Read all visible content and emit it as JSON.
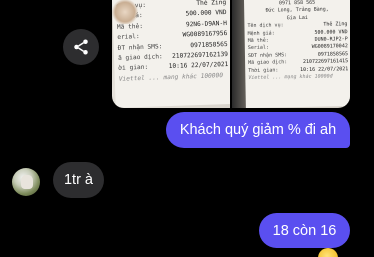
{
  "colors": {
    "background": "#000000",
    "outgoing_bubble": "#5a4ff0",
    "incoming_bubble": "#2d2d2f",
    "share_button": "#2d2d2f"
  },
  "photos": {
    "left_receipt": {
      "lines": [
        {
          "label": "dịch vụ:",
          "value": "Thẻ Zing"
        },
        {
          "label": "nh giá:",
          "value": "500.000 VND"
        },
        {
          "label": "Mã thẻ:",
          "value": "92N6-D9AN-H"
        },
        {
          "label": "erial:",
          "value": "WG0089167956"
        },
        {
          "label": "ĐT nhận SMS:",
          "value": "0971858565"
        },
        {
          "label": "ã giao dịch:",
          "value": "210722697162139"
        },
        {
          "label": "ời gian:",
          "value": "10:16 22/07/2021"
        }
      ],
      "footer": "Viettel ... mang khác 100000"
    },
    "right_receipt": {
      "header_lines": [
        "0971 858 565",
        "Đức Long, Trảng Bàng,",
        "Gia Lai"
      ],
      "lines": [
        {
          "label": "Tên dịch vụ:",
          "value": "Thẻ Zing"
        },
        {
          "label": "Mệnh giá:",
          "value": "500.000 VND"
        },
        {
          "label": "Mã thẻ:",
          "value": "DUN0-RJP2-P"
        },
        {
          "label": "Serial:",
          "value": "WG0089170042"
        },
        {
          "label": "SĐT nhận SMS:",
          "value": "0971858565"
        },
        {
          "label": "Mã giao dịch:",
          "value": "210722697161415"
        },
        {
          "label": "Thời gian:",
          "value": "10:16 22/07/2021"
        }
      ],
      "footer": "Viettel ... mạng khác 10000đ"
    }
  },
  "share_icon": "share-icon",
  "messages": [
    {
      "direction": "outgoing",
      "text": "Khách quý giảm % đi ah"
    },
    {
      "direction": "incoming",
      "text": "1tr à"
    },
    {
      "direction": "outgoing",
      "text": "18 còn 16"
    }
  ],
  "reaction_emoji": "emoji-reaction"
}
